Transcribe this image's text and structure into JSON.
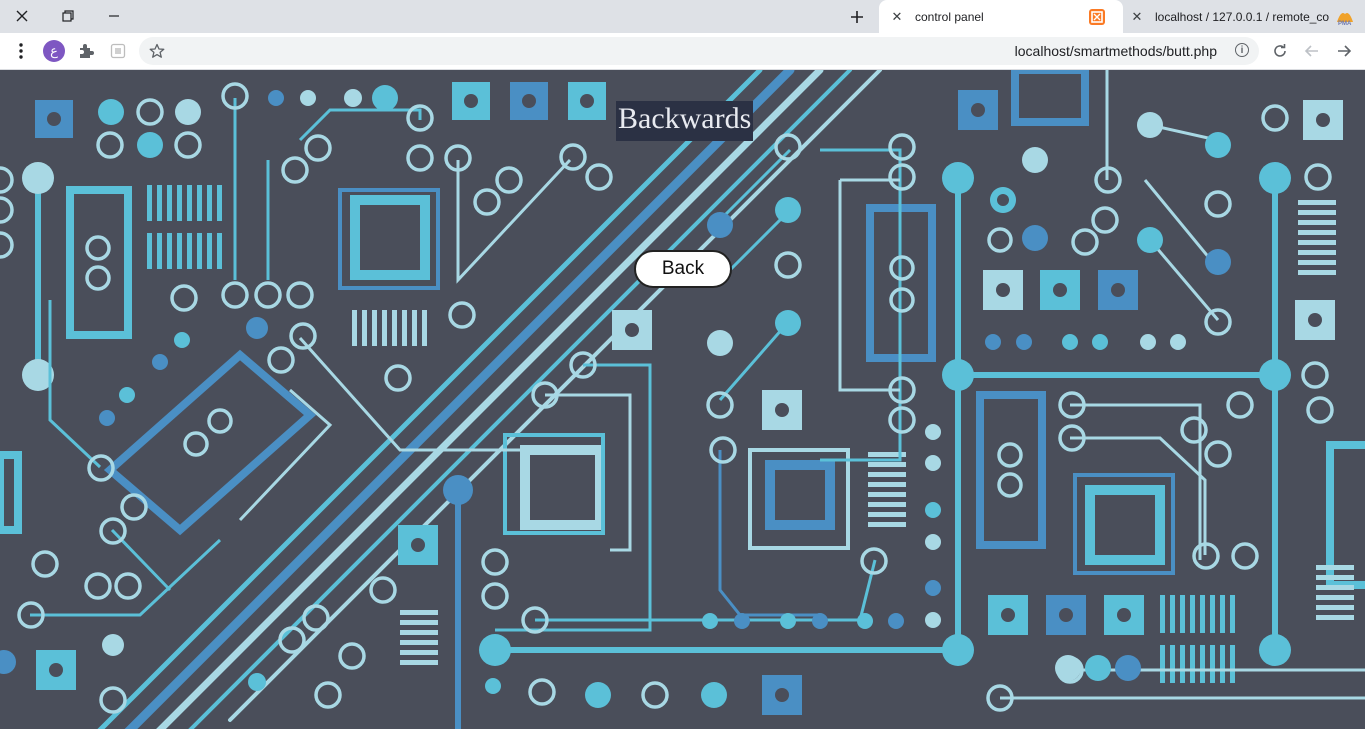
{
  "browser": {
    "tabs": [
      {
        "title": "control panel",
        "active": true
      },
      {
        "title": "localhost / 127.0.0.1 / remote_co",
        "active": false
      }
    ],
    "address_bar": {
      "url": "localhost/smartmethods/butt.php"
    },
    "profile_initial": "ع",
    "icons": {
      "close_window": "close-icon",
      "restore": "restore-icon",
      "minimize": "minimize-icon",
      "new_tab": "plus-icon",
      "menu": "kebab-menu-icon",
      "extensions": "puzzle-icon",
      "bookmark": "star-icon",
      "site_info": "info-icon",
      "reload": "reload-icon",
      "back": "arrow-left-icon",
      "forward": "arrow-right-icon"
    }
  },
  "page": {
    "heading": "Backwards",
    "back_button": "Back",
    "colors": {
      "background": "#4a4e5a",
      "circuit_light": "#5bc0d8",
      "circuit_mid": "#4a8fc4",
      "circuit_pale": "#a8d8e4",
      "heading_bg": "#2b3144"
    }
  }
}
